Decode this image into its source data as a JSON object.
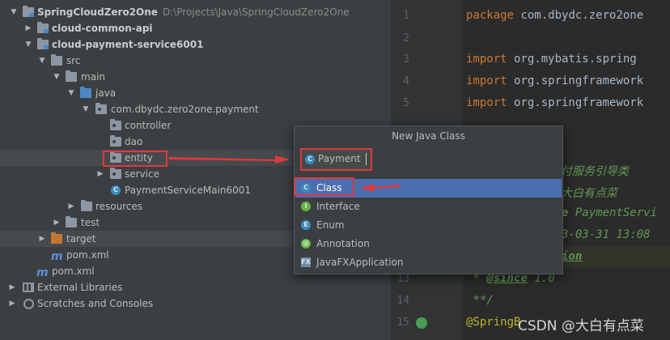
{
  "tree": {
    "project_name": "SpringCloudZero2One",
    "project_path": "D:\\Projects\\Java\\SpringCloudZero2One",
    "module_common": "cloud-common-api",
    "module_payment": "cloud-payment-service6001",
    "src": "src",
    "main": "main",
    "java": "java",
    "package": "com.dbydc.zero2one.payment",
    "controller": "controller",
    "dao": "dao",
    "entity": "entity",
    "service": "service",
    "main_class": "PaymentServiceMain6001",
    "resources": "resources",
    "test": "test",
    "target": "target",
    "pom_module": "pom.xml",
    "pom_root": "pom.xml",
    "external_libraries": "External Libraries",
    "scratches": "Scratches and Consoles"
  },
  "editor": {
    "line_numbers": [
      "1",
      "2",
      "3",
      "4",
      "5",
      "13",
      "14",
      "15"
    ],
    "line1_keyword": "package",
    "line1_text": " com.dbydc.zero2one",
    "import_keyword": "import",
    "import1": " org.mybatis.spring",
    "import2": " org.springframework",
    "import3": " org.springframework",
    "comment1": "付服务引导类",
    "comment2": "大白有点菜",
    "comment3_kw": "e",
    "comment3_text": " PaymentServi",
    "comment4": "3-03-31 13:08",
    "comment5": "ion",
    "since_prefix": " * ",
    "since_tag": "@since",
    "since_value": " 1.0",
    "comment_end": " **/",
    "annotation": "@SpringB"
  },
  "popup": {
    "title": "New Java Class",
    "name_value": "Payment",
    "options": [
      "Class",
      "Interface",
      "Enum",
      "Annotation",
      "JavaFXApplication"
    ],
    "option_icons": [
      "C",
      "I",
      "E",
      "@",
      "FX"
    ],
    "selected_index": 0
  },
  "watermark": "CSDN @大白有点菜",
  "colors": {
    "annotation_red": "#e0393e",
    "selection_blue": "#4b6eaf"
  }
}
